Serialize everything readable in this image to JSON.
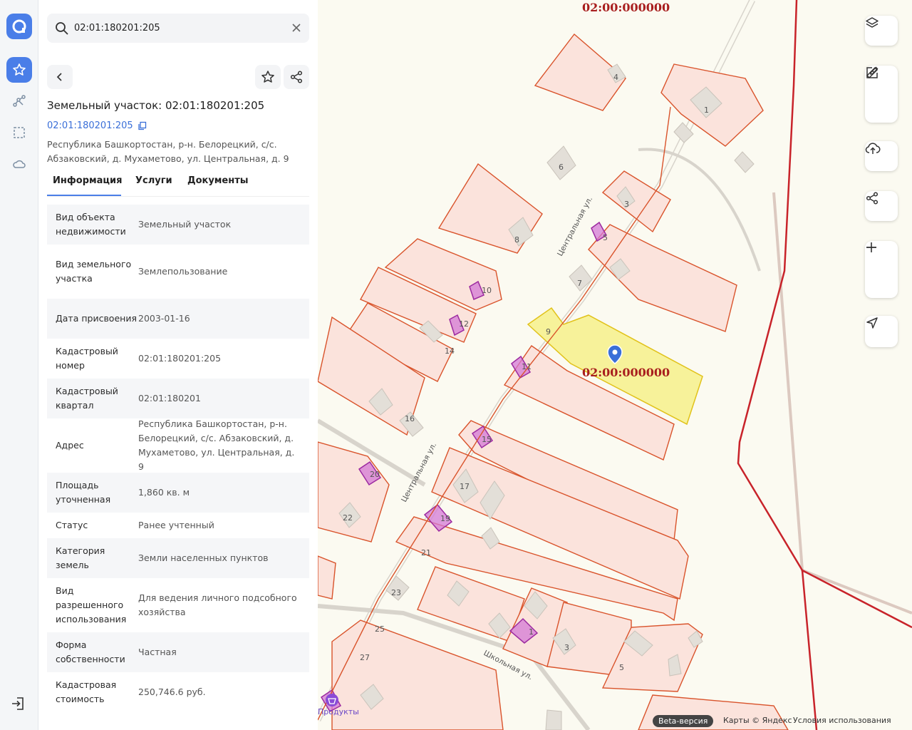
{
  "search": {
    "value": "02:01:180201:205"
  },
  "object": {
    "title": "Земельный участок: 02:01:180201:205",
    "cadastral_link": "02:01:180201:205",
    "address": "Республика Башкортостан, р-н. Белорецкий, с/с. Абзаковский, д. Мухаметово, ул. Центральная, д. 9"
  },
  "tabs": [
    {
      "label": "Информация"
    },
    {
      "label": "Услуги"
    },
    {
      "label": "Документы"
    }
  ],
  "info_rows": [
    {
      "key": "Вид объекта недвижимости",
      "value": "Земельный участок"
    },
    {
      "key": "Вид земельного участка",
      "value": "Землепользование"
    },
    {
      "key": "Дата присвоения",
      "value": "2003-01-16"
    },
    {
      "key": "Кадастровый номер",
      "value": "02:01:180201:205"
    },
    {
      "key": "Кадастровый квартал",
      "value": "02:01:180201"
    },
    {
      "key": "Адрес",
      "value": "Республика Башкортостан, р-н. Белорецкий, с/с. Абзаковский, д. Мухаметово, ул. Центральная, д. 9"
    },
    {
      "key": "Площадь уточненная",
      "value": "1,860 кв. м"
    },
    {
      "key": "Статус",
      "value": "Ранее учтенный"
    },
    {
      "key": "Категория земель",
      "value": "Земли населенных пунктов"
    },
    {
      "key": "Вид разрешенного использования",
      "value": "Для ведения личного подсобного хозяйства"
    },
    {
      "key": "Форма собственности",
      "value": "Частная"
    },
    {
      "key": "Кадастровая стоимость",
      "value": "250,746.6 руб."
    }
  ],
  "map": {
    "plot_label_top": "02:00:000000",
    "plot_label_center": "02:00:000000",
    "streets": {
      "central_1": "Центральная ул.",
      "central_2": "Центральная ул.",
      "school": "Школьная ул."
    },
    "house_numbers": [
      "4",
      "1",
      "6",
      "3",
      "8",
      "5",
      "7",
      "10",
      "9",
      "12",
      "14",
      "11",
      "16",
      "15",
      "20",
      "17",
      "22",
      "19",
      "21",
      "23",
      "25",
      "1",
      "3",
      "27",
      "5"
    ],
    "poi": "Продукты",
    "beta": "Beta-версия",
    "attribution": "Карты © Яндекс",
    "terms": "Условия использования"
  },
  "colors": {
    "accent": "#4a7ee8",
    "selected_plot": "#f7f29a",
    "parcel_border": "#d9532b",
    "parcel_fill": "#fbe3dc",
    "building_mark": "#c84bc9"
  }
}
